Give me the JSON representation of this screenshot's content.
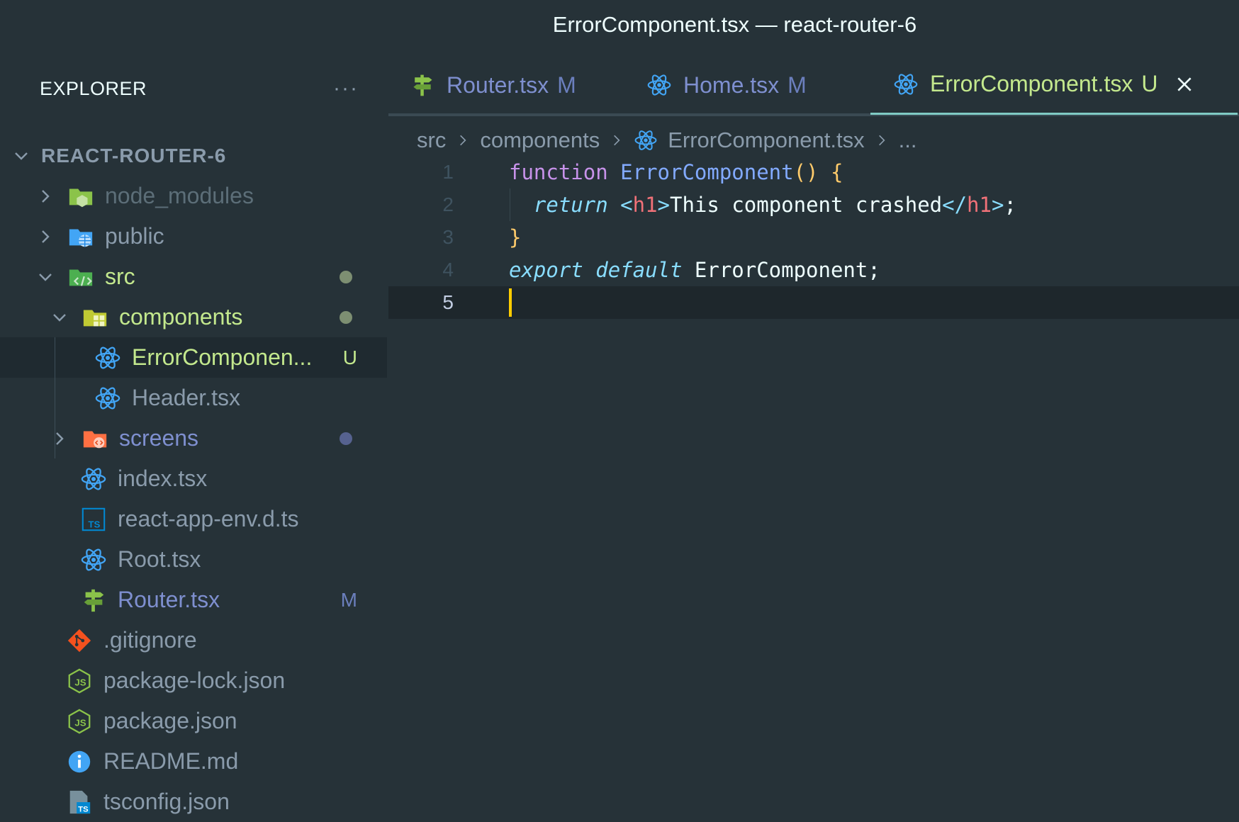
{
  "window": {
    "title": "ErrorComponent.tsx — react-router-6"
  },
  "explorer": {
    "title": "EXPLORER",
    "more": "···",
    "root": "REACT-ROUTER-6",
    "items": [
      {
        "label": "node_modules",
        "badge": ""
      },
      {
        "label": "public",
        "badge": ""
      },
      {
        "label": "src",
        "badge": ""
      },
      {
        "label": "components",
        "badge": ""
      },
      {
        "label": "ErrorComponen...",
        "badge": "U"
      },
      {
        "label": "Header.tsx",
        "badge": ""
      },
      {
        "label": "screens",
        "badge": ""
      },
      {
        "label": "index.tsx",
        "badge": ""
      },
      {
        "label": "react-app-env.d.ts",
        "badge": ""
      },
      {
        "label": "Root.tsx",
        "badge": ""
      },
      {
        "label": "Router.tsx",
        "badge": "M"
      },
      {
        "label": ".gitignore",
        "badge": ""
      },
      {
        "label": "package-lock.json",
        "badge": ""
      },
      {
        "label": "package.json",
        "badge": ""
      },
      {
        "label": "README.md",
        "badge": ""
      },
      {
        "label": "tsconfig.json",
        "badge": ""
      }
    ]
  },
  "tabs": [
    {
      "label": "Router.tsx",
      "mark": "M"
    },
    {
      "label": "Home.tsx",
      "mark": "M"
    },
    {
      "label": "ErrorComponent.tsx",
      "mark": "U"
    }
  ],
  "breadcrumb": {
    "p1": "src",
    "p2": "components",
    "p3": "ErrorComponent.tsx",
    "p4": "..."
  },
  "code": {
    "ln1": "1",
    "ln2": "2",
    "ln3": "3",
    "ln4": "4",
    "ln5": "5",
    "l1_kw": "function",
    "l1_fn": "ErrorComponent",
    "l1_punc": "() {",
    "l2_ret": "return",
    "l2_lt": "<",
    "l2_tag": "h1",
    "l2_gt": ">",
    "l2_text": "This component crashed",
    "l2_lt2": "</",
    "l2_tag2": "h1",
    "l2_gt2": ">",
    "l2_semi": ";",
    "l3_brace": "}",
    "l4_export": "export",
    "l4_default": "default",
    "l4_name": "ErrorComponent;"
  },
  "colors": {
    "background": "#263238",
    "git_modified": "#6b7fbd",
    "git_untracked": "#c3e88d",
    "cursor": "#ffcc00"
  }
}
